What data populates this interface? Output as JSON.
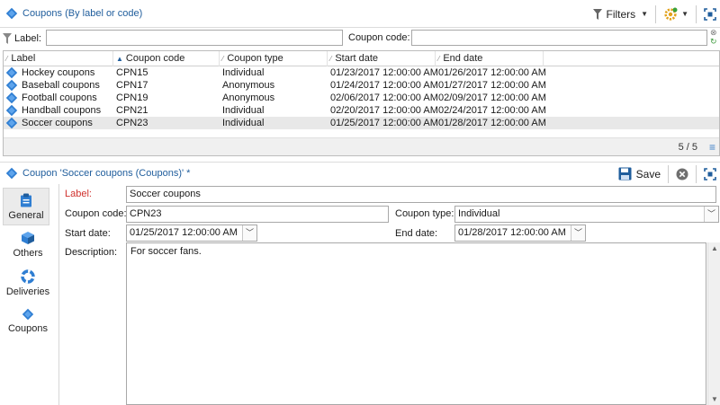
{
  "list_window": {
    "title": "Coupons (By label or code)",
    "filters_label": "Filters",
    "filter": {
      "label_text": "Label:",
      "label_value": "",
      "code_text": "Coupon code:",
      "code_value": ""
    },
    "columns": [
      "Label",
      "Coupon code",
      "Coupon type",
      "Start date",
      "End date"
    ],
    "rows": [
      {
        "label": "Hockey coupons",
        "code": "CPN15",
        "type": "Individual",
        "start": "01/23/2017 12:00:00 AM",
        "end": "01/26/2017 12:00:00 AM"
      },
      {
        "label": "Baseball coupons",
        "code": "CPN17",
        "type": "Anonymous",
        "start": "01/24/2017 12:00:00 AM",
        "end": "01/27/2017 12:00:00 AM"
      },
      {
        "label": "Football coupons",
        "code": "CPN19",
        "type": "Anonymous",
        "start": "02/06/2017 12:00:00 AM",
        "end": "02/09/2017 12:00:00 AM"
      },
      {
        "label": "Handball coupons",
        "code": "CPN21",
        "type": "Individual",
        "start": "02/20/2017 12:00:00 AM",
        "end": "02/24/2017 12:00:00 AM"
      },
      {
        "label": "Soccer coupons",
        "code": "CPN23",
        "type": "Individual",
        "start": "01/25/2017 12:00:00 AM",
        "end": "01/28/2017 12:00:00 AM"
      }
    ],
    "count": "5 / 5"
  },
  "detail_window": {
    "title": "Coupon 'Soccer coupons (Coupons)' *",
    "save_label": "Save",
    "nav": [
      "General",
      "Others",
      "Deliveries",
      "Coupons"
    ],
    "form": {
      "label_caption": "Label:",
      "label_value": "Soccer coupons",
      "code_caption": "Coupon code:",
      "code_value": "CPN23",
      "type_caption": "Coupon type:",
      "type_value": "Individual",
      "start_caption": "Start date:",
      "start_value": "01/25/2017 12:00:00 AM",
      "end_caption": "End date:",
      "end_value": "01/28/2017 12:00:00 AM",
      "desc_caption": "Description:",
      "desc_value": "For soccer fans."
    }
  },
  "icons": {
    "coupon": "coupon-icon",
    "filter": "filter-icon",
    "gear": "gear-icon",
    "expand": "expand-icon",
    "save": "save-icon",
    "cancel": "cancel-icon",
    "clear": "clear-icon",
    "refresh": "refresh-icon",
    "menu": "menu-icon"
  },
  "colors": {
    "accent": "#1f5d9c",
    "required": "#d0312d",
    "selected_row": "#e8e8e8"
  }
}
